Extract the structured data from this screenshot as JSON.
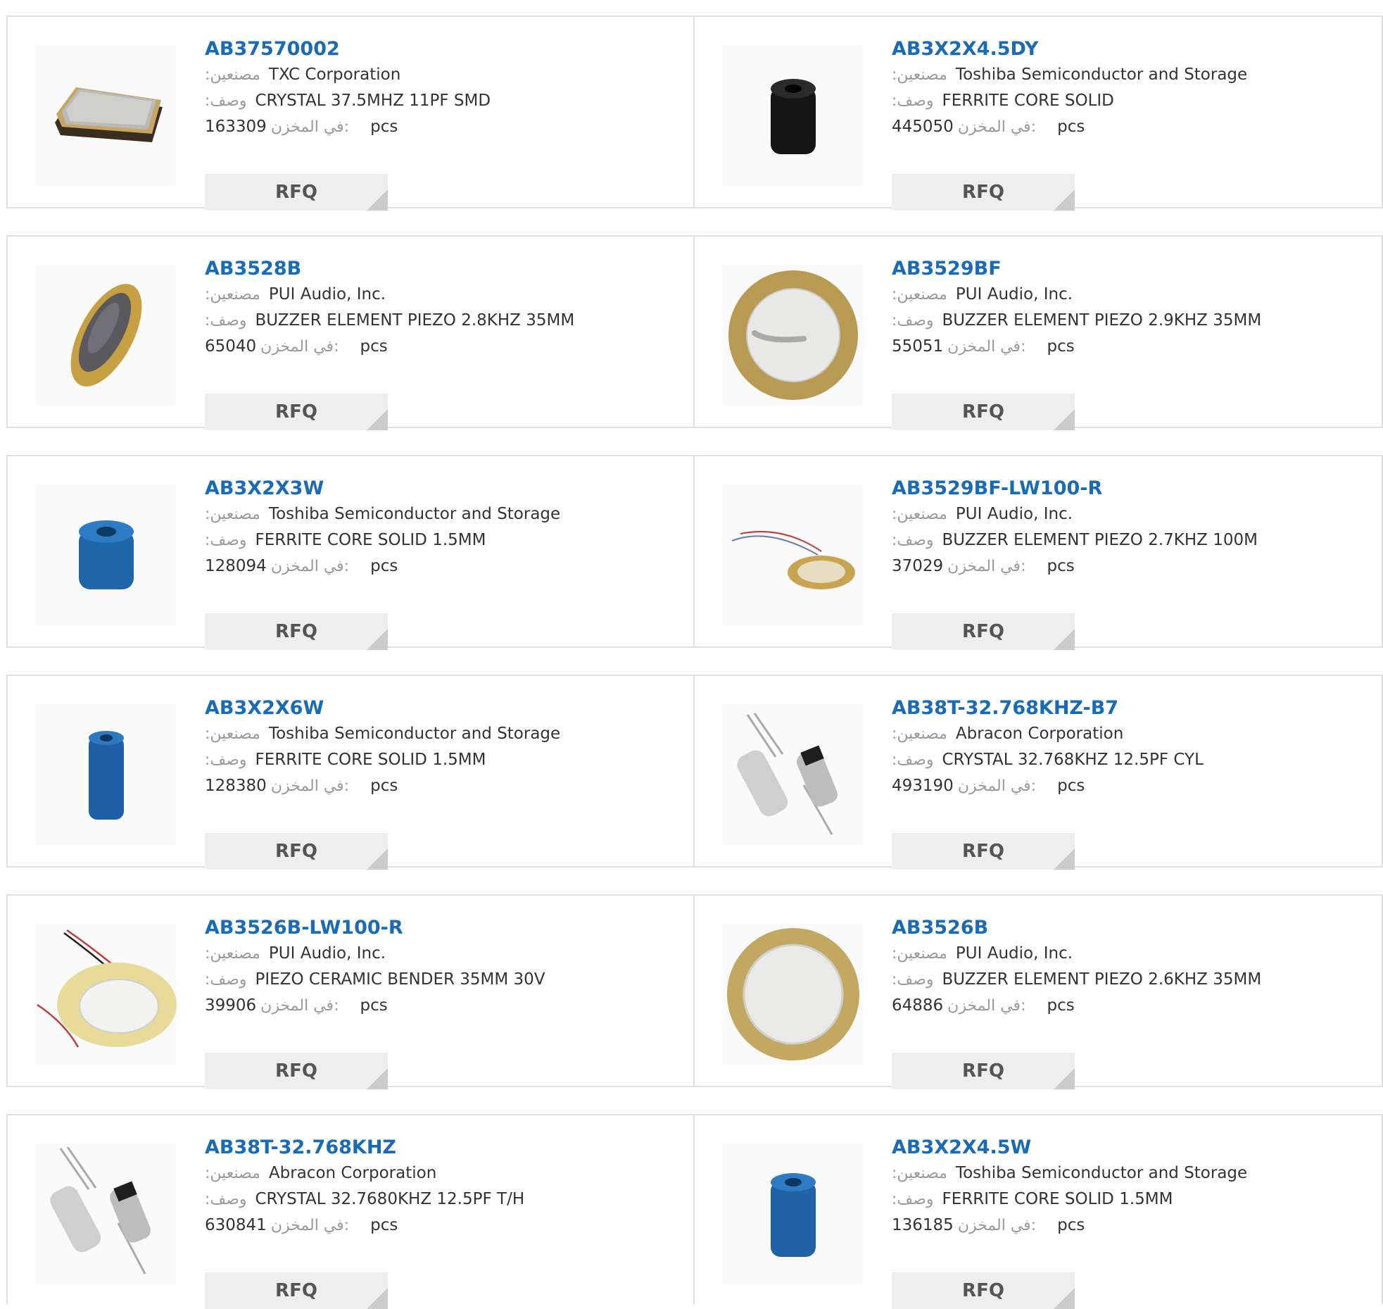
{
  "labels": {
    "manufacturer": ":مصنعين",
    "description": ":وصف",
    "stock": "في المخزن:",
    "unit": "pcs",
    "rfq": "RFQ"
  },
  "products": [
    {
      "pn": "AB37570002",
      "mfr": "TXC Corporation",
      "desc": "CRYSTAL 37.5MHZ 11PF SMD",
      "stock": "163309",
      "image": "smd-crystal-image"
    },
    {
      "pn": "AB3X2X4.5DY",
      "mfr": "Toshiba Semiconductor and Storage",
      "desc": "FERRITE CORE SOLID",
      "stock": "445050",
      "image": "black-ferrite-core-image"
    },
    {
      "pn": "AB3528B",
      "mfr": "PUI Audio, Inc.",
      "desc": "BUZZER ELEMENT PIEZO 2.8KHZ 35MM",
      "stock": "65040",
      "image": "piezo-element-angled-image"
    },
    {
      "pn": "AB3529BF",
      "mfr": "PUI Audio, Inc.",
      "desc": "BUZZER ELEMENT PIEZO 2.9KHZ 35MM",
      "stock": "55051",
      "image": "piezo-disc-image"
    },
    {
      "pn": "AB3X2X3W",
      "mfr": "Toshiba Semiconductor and Storage",
      "desc": "FERRITE CORE SOLID 1.5MM",
      "stock": "128094",
      "image": "blue-ferrite-core-image"
    },
    {
      "pn": "AB3529BF-LW100-R",
      "mfr": "PUI Audio, Inc.",
      "desc": "BUZZER ELEMENT PIEZO 2.7KHZ 100M",
      "stock": "37029",
      "image": "piezo-with-leads-image"
    },
    {
      "pn": "AB3X2X6W",
      "mfr": "Toshiba Semiconductor and Storage",
      "desc": "FERRITE CORE SOLID 1.5MM",
      "stock": "128380",
      "image": "blue-ferrite-tube-image"
    },
    {
      "pn": "AB38T-32.768KHZ-B7",
      "mfr": "Abracon Corporation",
      "desc": "CRYSTAL 32.768KHZ 12.5PF CYL",
      "stock": "493190",
      "image": "cylinder-crystal-image"
    },
    {
      "pn": "AB3526B-LW100-R",
      "mfr": "PUI Audio, Inc.",
      "desc": "PIEZO CERAMIC BENDER 35MM 30V",
      "stock": "39906",
      "image": "piezo-bender-with-leads-image"
    },
    {
      "pn": "AB3526B",
      "mfr": "PUI Audio, Inc.",
      "desc": "BUZZER ELEMENT PIEZO 2.6KHZ 35MM",
      "stock": "64886",
      "image": "piezo-disc-plain-image"
    },
    {
      "pn": "AB38T-32.768KHZ",
      "mfr": "Abracon Corporation",
      "desc": "CRYSTAL 32.7680KHZ 12.5PF T/H",
      "stock": "630841",
      "image": "cylinder-crystal-image"
    },
    {
      "pn": "AB3X2X4.5W",
      "mfr": "Toshiba Semiconductor and Storage",
      "desc": "FERRITE CORE SOLID 1.5MM",
      "stock": "136185",
      "image": "blue-ferrite-core-image"
    }
  ]
}
